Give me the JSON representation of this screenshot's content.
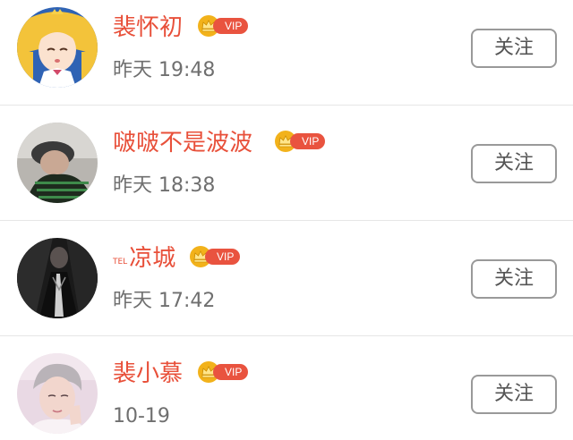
{
  "users": [
    {
      "prefix": "",
      "name": "裴怀初",
      "vip_label": "VIP",
      "time": "昨天 19:48",
      "follow_label": "关注",
      "avatar": "cartoon-girl-avatar"
    },
    {
      "prefix": "",
      "name": "啵啵不是波波",
      "vip_label": "VIP",
      "time": "昨天 18:38",
      "follow_label": "关注",
      "avatar": "photo-person-avatar"
    },
    {
      "prefix": "TEL",
      "name": "凉城",
      "vip_label": "VIP",
      "time": "昨天 17:42",
      "follow_label": "关注",
      "avatar": "dark-photo-avatar"
    },
    {
      "prefix": "",
      "name": "裴小慕",
      "vip_label": "VIP",
      "time": "10-19",
      "follow_label": "关注",
      "avatar": "photo-boy-avatar"
    }
  ],
  "colors": {
    "name": "#e8503a",
    "vip_pill": "#e9533f",
    "crown": "#f2b21b",
    "time": "#6f6f6f",
    "button_border": "#999999"
  }
}
